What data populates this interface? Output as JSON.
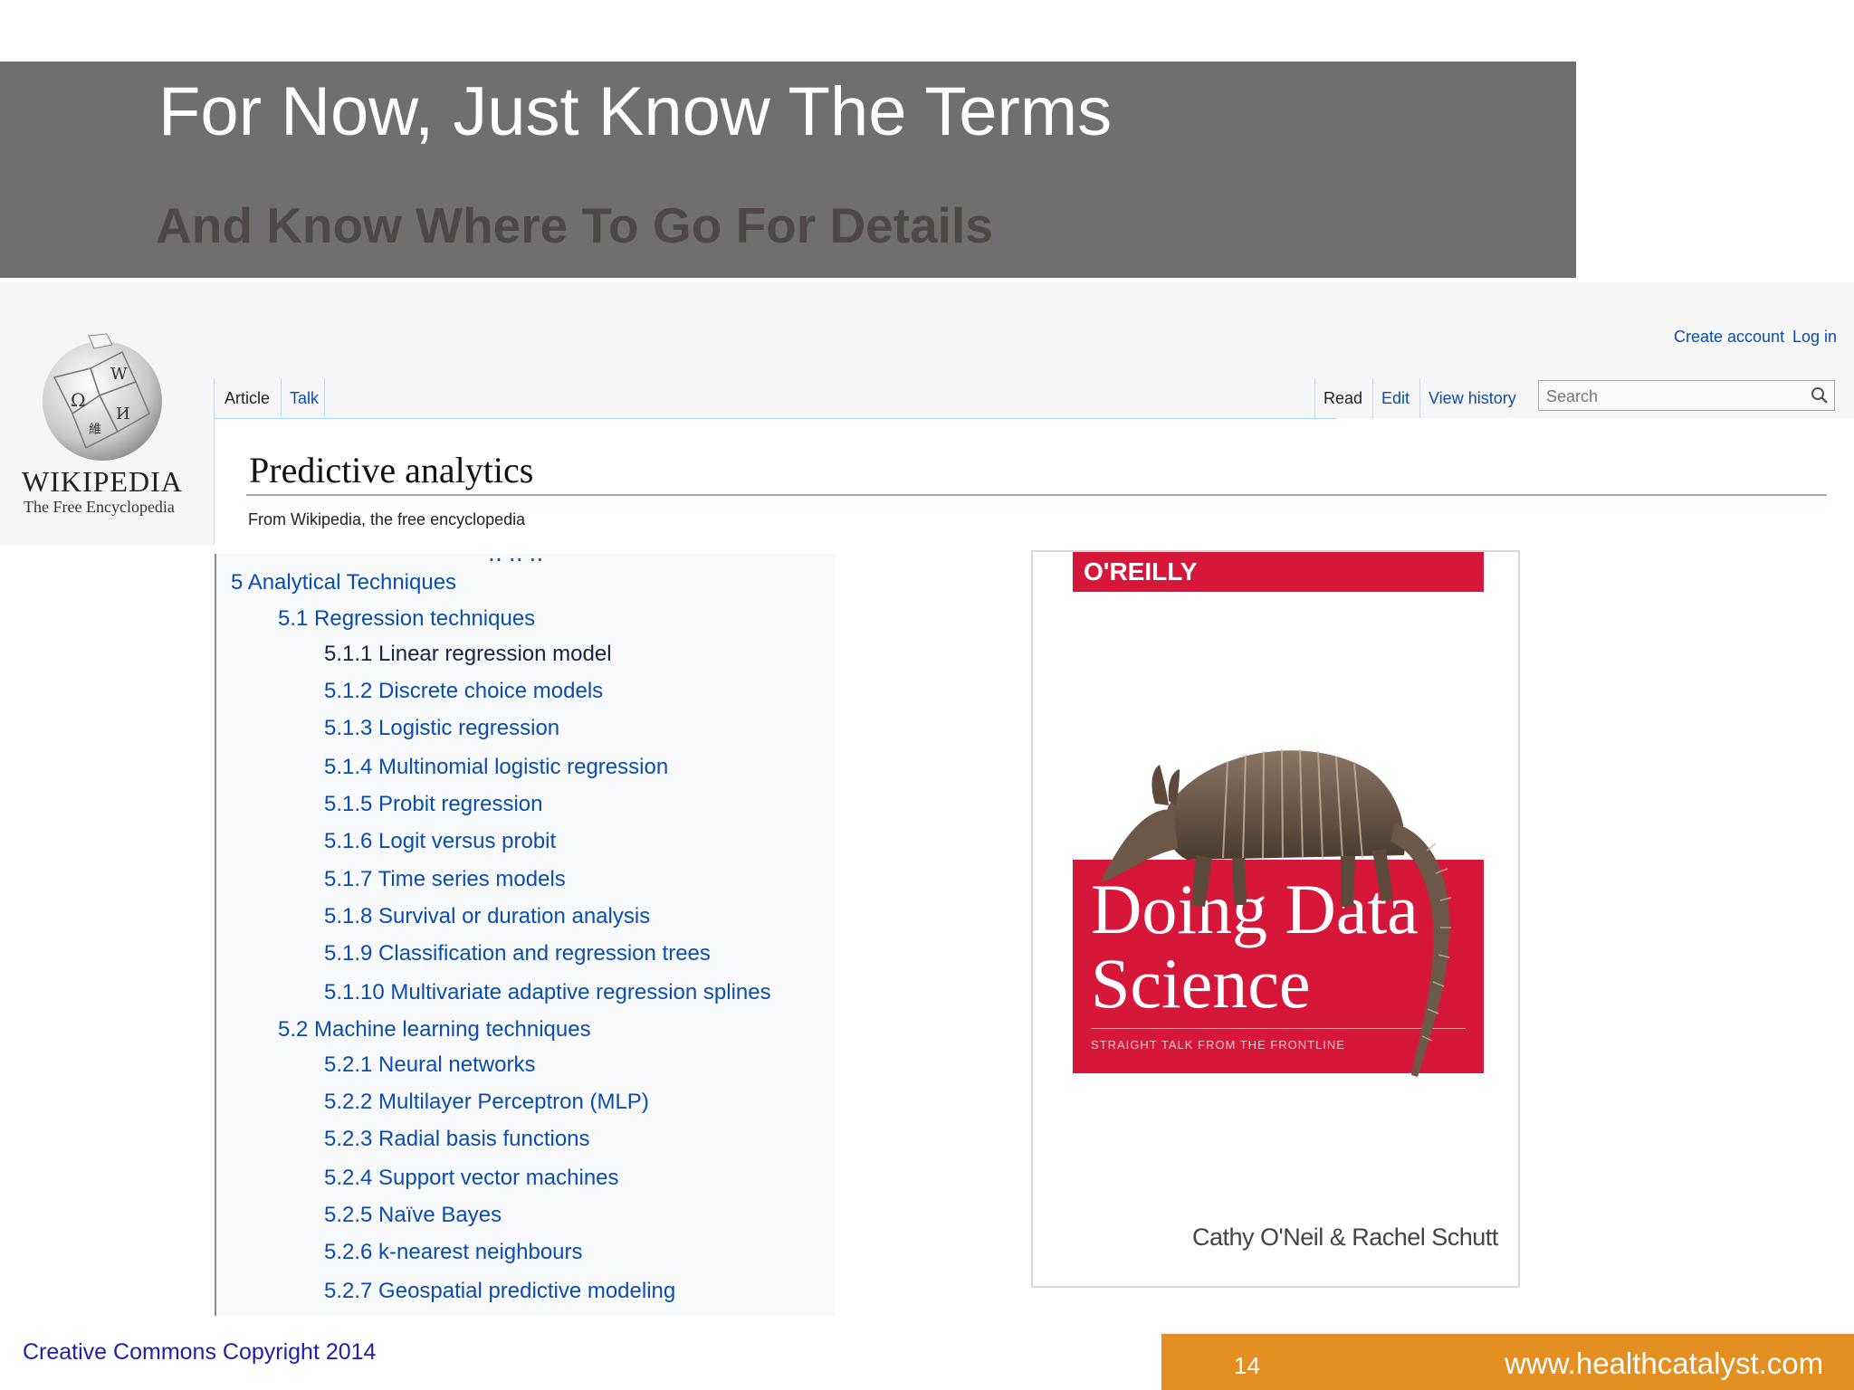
{
  "slide": {
    "title": "For Now, Just Know The Terms",
    "subtitle": "And Know Where To Go For Details"
  },
  "wikipedia": {
    "logo_word": "WIKIPEDIA",
    "logo_tagline": "The Free Encyclopedia",
    "account_links": {
      "create": "Create account",
      "login": "Log in"
    },
    "tabs_left": [
      "Article",
      "Talk"
    ],
    "tabs_right": [
      "Read",
      "Edit",
      "View history"
    ],
    "search_placeholder": "Search",
    "article_title": "Predictive analytics",
    "from_line": "From Wikipedia, the free encyclopedia"
  },
  "toc": {
    "items": [
      {
        "level": 1,
        "label": "5 Analytical Techniques"
      },
      {
        "level": 2,
        "label": "5.1 Regression techniques"
      },
      {
        "level": 3,
        "label": "5.1.1 Linear regression model"
      },
      {
        "level": 3,
        "label": "5.1.2 Discrete choice models"
      },
      {
        "level": 3,
        "label": "5.1.3 Logistic regression"
      },
      {
        "level": 3,
        "label": "5.1.4 Multinomial logistic regression"
      },
      {
        "level": 3,
        "label": "5.1.5 Probit regression"
      },
      {
        "level": 3,
        "label": "5.1.6 Logit versus probit"
      },
      {
        "level": 3,
        "label": "5.1.7 Time series models"
      },
      {
        "level": 3,
        "label": "5.1.8 Survival or duration analysis"
      },
      {
        "level": 3,
        "label": "5.1.9 Classification and regression trees"
      },
      {
        "level": 3,
        "label": "5.1.10 Multivariate adaptive regression splines"
      },
      {
        "level": 2,
        "label": "5.2 Machine learning techniques"
      },
      {
        "level": 3,
        "label": "5.2.1 Neural networks"
      },
      {
        "level": 3,
        "label": "5.2.2 Multilayer Perceptron (MLP)"
      },
      {
        "level": 3,
        "label": "5.2.3 Radial basis functions"
      },
      {
        "level": 3,
        "label": "5.2.4 Support vector machines"
      },
      {
        "level": 3,
        "label": "5.2.5 Naïve Bayes"
      },
      {
        "level": 3,
        "label": "5.2.6 k-nearest neighbours"
      },
      {
        "level": 3,
        "label": "5.2.7 Geospatial predictive modeling"
      }
    ]
  },
  "book": {
    "publisher": "O'REILLY",
    "title_line1": "Doing Data",
    "title_line2": "Science",
    "tagline": "STRAIGHT TALK FROM THE FRONTLINE",
    "authors": "Cathy O'Neil & Rachel Schutt",
    "color": "#d6173a"
  },
  "footer": {
    "copyright": "Creative Commons Copyright 2014",
    "page_number": "14",
    "website": "www.healthcatalyst.com",
    "accent": "#e38f21"
  }
}
